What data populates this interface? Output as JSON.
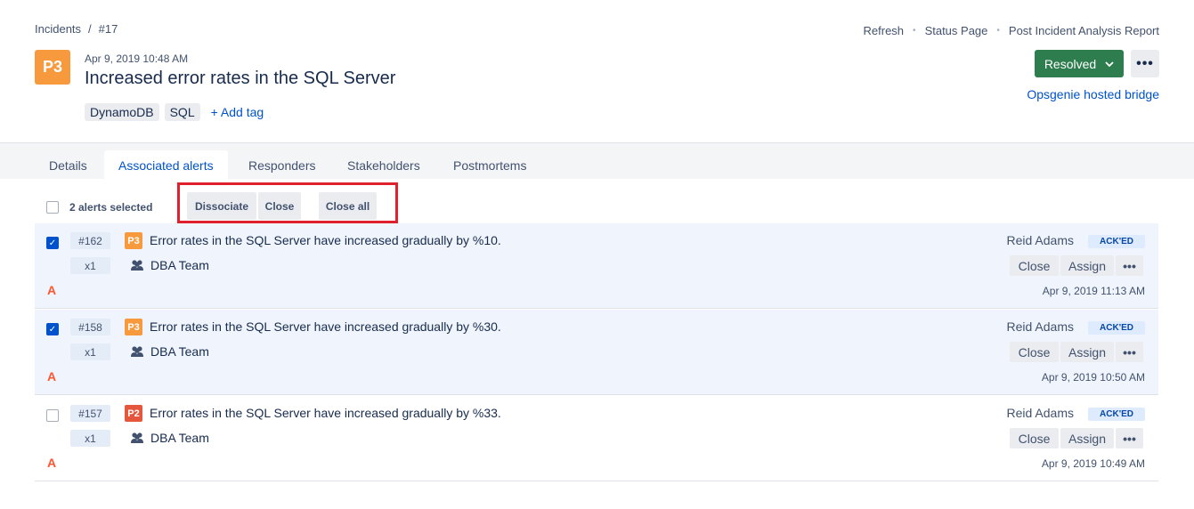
{
  "breadcrumb": {
    "root": "Incidents",
    "sep": "/",
    "current": "#17"
  },
  "top_links": [
    "Refresh",
    "Status Page",
    "Post Incident Analysis Report"
  ],
  "incident": {
    "priority": "P3",
    "date": "Apr 9, 2019 10:48 AM",
    "title": "Increased error rates in the SQL Server",
    "tags": [
      "DynamoDB",
      "SQL"
    ],
    "add_tag": "+ Add tag",
    "status": "Resolved",
    "bridge_link": "Opsgenie hosted bridge"
  },
  "tabs": [
    "Details",
    "Associated alerts",
    "Responders",
    "Stakeholders",
    "Postmortems"
  ],
  "active_tab": "Associated alerts",
  "selection": {
    "text": "2 alerts selected"
  },
  "bulk_actions": {
    "dissociate": "Dissociate",
    "close": "Close",
    "close_all": "Close all"
  },
  "alerts": [
    {
      "id": "#162",
      "count": "x1",
      "priority": "P3",
      "priority_color": "#f79a3e",
      "message": "Error rates in the SQL Server have increased gradually by %10.",
      "team": "DBA Team",
      "source": "A",
      "owner": "Reid Adams",
      "status": "ACK'ED",
      "close": "Close",
      "assign": "Assign",
      "time": "Apr 9, 2019 11:13 AM",
      "selected": true
    },
    {
      "id": "#158",
      "count": "x1",
      "priority": "P3",
      "priority_color": "#f79a3e",
      "message": "Error rates in the SQL Server have increased gradually by %30.",
      "team": "DBA Team",
      "source": "A",
      "owner": "Reid Adams",
      "status": "ACK'ED",
      "close": "Close",
      "assign": "Assign",
      "time": "Apr 9, 2019 10:50 AM",
      "selected": true
    },
    {
      "id": "#157",
      "count": "x1",
      "priority": "P2",
      "priority_color": "#e5573c",
      "message": "Error rates in the SQL Server have increased gradually by %33.",
      "team": "DBA Team",
      "source": "A",
      "owner": "Reid Adams",
      "status": "ACK'ED",
      "close": "Close",
      "assign": "Assign",
      "time": "Apr 9, 2019 10:49 AM",
      "selected": false
    }
  ]
}
